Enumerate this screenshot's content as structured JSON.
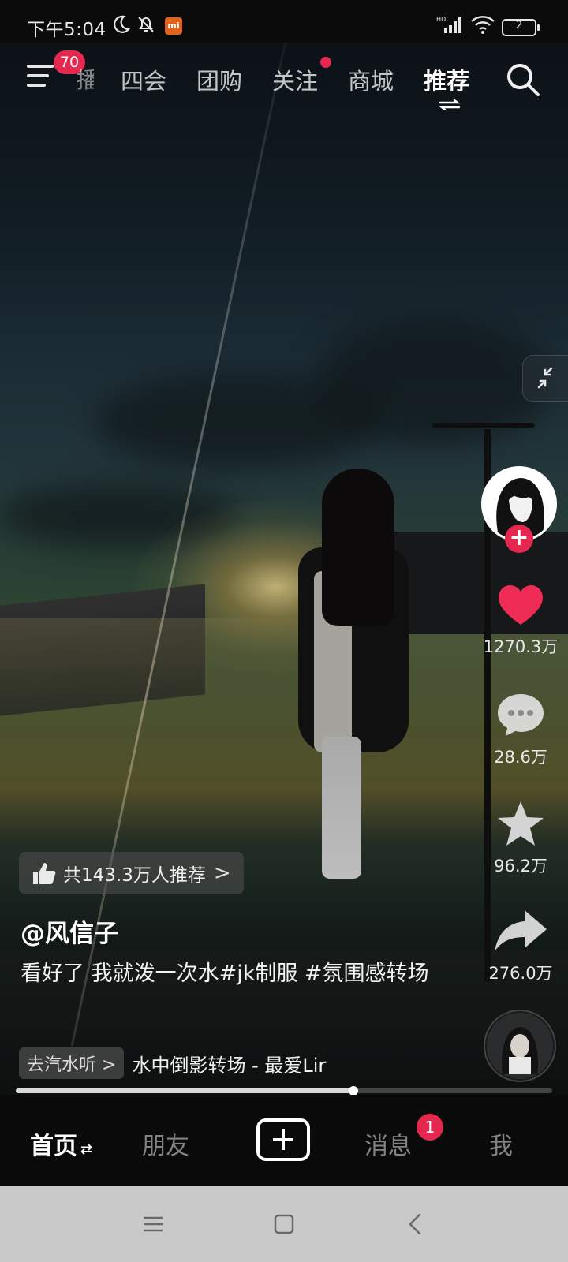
{
  "status_bar": {
    "time": "下午5:04",
    "icons": [
      "moon-icon",
      "mute-bell-icon",
      "mi-app-icon",
      "hd-signal-icon",
      "wifi-icon",
      "battery-icon"
    ],
    "battery_level": "2",
    "mi_label": "mi"
  },
  "top_nav": {
    "menu_badge": "70",
    "partial_tab": "播",
    "tabs": [
      {
        "label": "四会",
        "active": false
      },
      {
        "label": "团购",
        "active": false
      },
      {
        "label": "关注",
        "active": false,
        "dot": true
      },
      {
        "label": "商城",
        "active": false
      },
      {
        "label": "推荐",
        "active": true
      }
    ]
  },
  "right_rail": {
    "like_count": "1270.3万",
    "comment_count": "28.6万",
    "favorite_count": "96.2万",
    "share_count": "276.0万",
    "follow_symbol": "+"
  },
  "video_info": {
    "recommend_text": "共143.3万人推荐",
    "recommend_chevron": ">",
    "author": "@风信子",
    "caption": "看好了 我就泼一次水#jk制服 #氛围感转场",
    "music_tag": "去汽水听",
    "music_tag_chevron": ">",
    "music_title": "水中倒影转场 - 最爱Lir"
  },
  "progress": {
    "played_fraction": 0.63
  },
  "bottom_nav": {
    "home": "首页",
    "home_swap": "⇄",
    "friends": "朋友",
    "messages": "消息",
    "messages_badge": "1",
    "me": "我"
  },
  "colors": {
    "accent": "#e52850",
    "system_nav_bg": "#c9c9c9"
  }
}
